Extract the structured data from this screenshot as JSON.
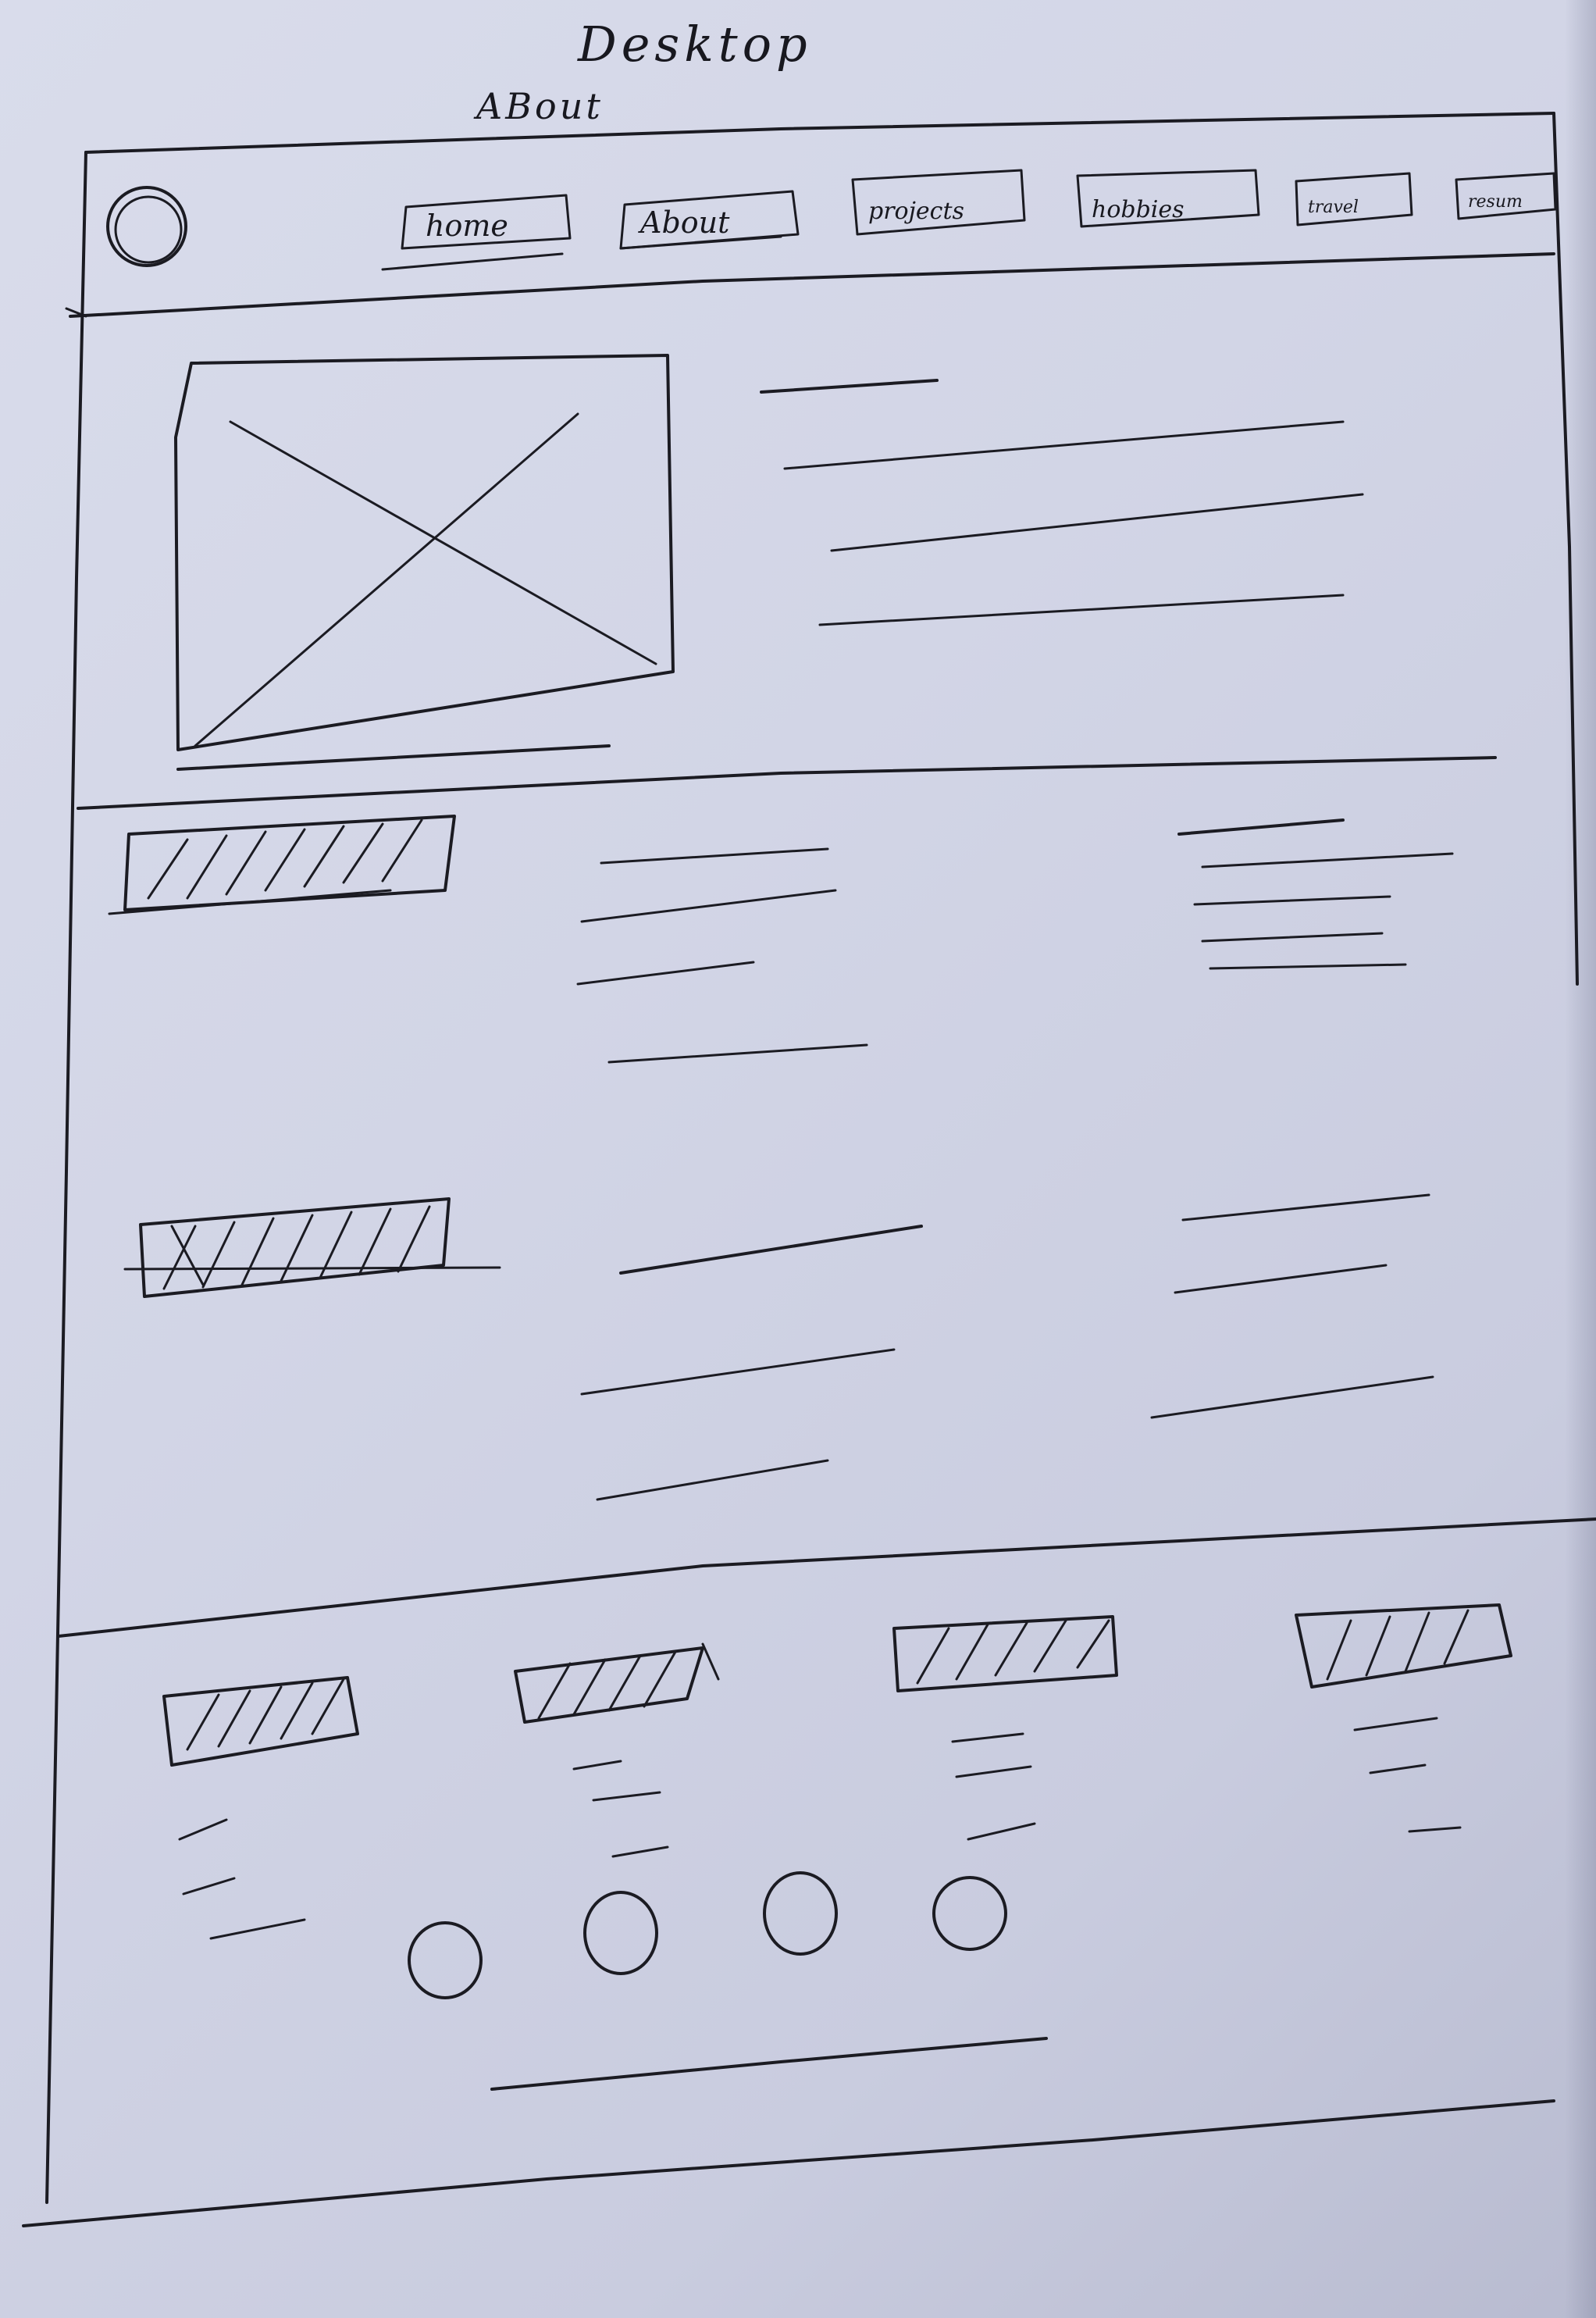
{
  "page": {
    "title": "Desktop",
    "subtitle": "ABout"
  },
  "nav": {
    "items": [
      {
        "label": "home"
      },
      {
        "label": "About"
      },
      {
        "label": "projects"
      },
      {
        "label": "hobbies"
      },
      {
        "label": "travel"
      },
      {
        "label": "resum"
      }
    ]
  },
  "hero": {
    "image_placeholder": "image-placeholder-x",
    "text_lines": 4
  },
  "sections": {
    "rows": 2,
    "cards": 4,
    "social_icons": 4
  },
  "colors": {
    "paper": "#d4d7e8",
    "ink": "#1b1b22"
  }
}
